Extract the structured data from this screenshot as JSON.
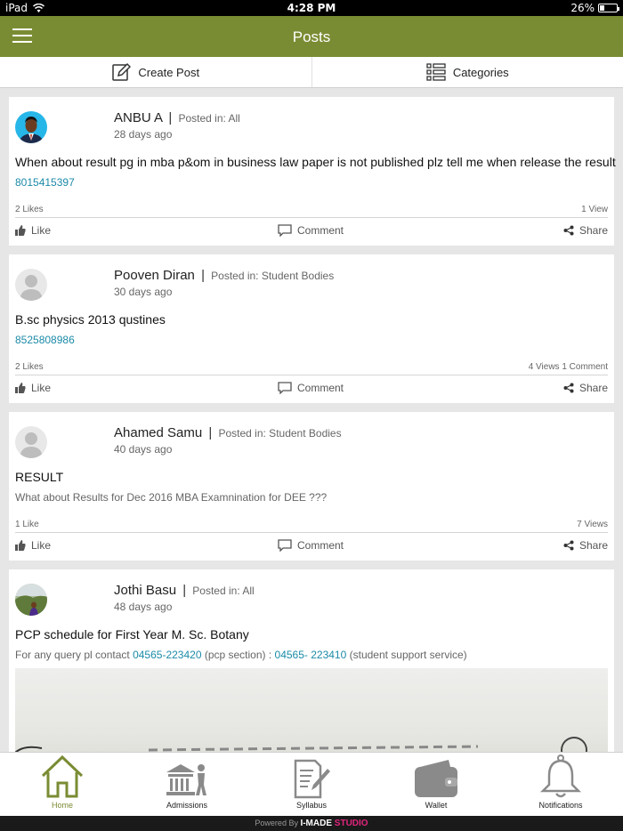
{
  "status": {
    "carrier": "iPad",
    "time": "4:28 PM",
    "battery": "26%"
  },
  "header": {
    "title": "Posts"
  },
  "actionbar": {
    "create_label": "Create Post",
    "categories_label": "Categories"
  },
  "actions": {
    "like": "Like",
    "comment": "Comment",
    "share": "Share"
  },
  "posts": [
    {
      "author": "ANBU A",
      "sep": "|",
      "posted_in": "Posted in: All",
      "ago": "28 days ago",
      "title": "When about result pg in mba p&om in business law paper is not published plz tell me when release the result",
      "body": "8015415397",
      "likes": "2 Likes",
      "views": "1 View"
    },
    {
      "author": "Pooven Diran",
      "sep": "|",
      "posted_in": "Posted in: Student Bodies",
      "ago": "30 days ago",
      "title": "B.sc physics 2013 qustines",
      "body": "8525808986",
      "likes": "2 Likes",
      "views": "4 Views 1 Comment"
    },
    {
      "author": "Ahamed Samu",
      "sep": "|",
      "posted_in": "Posted in: Student Bodies",
      "ago": "40 days ago",
      "title": "RESULT",
      "body": "What about Results for Dec 2016 MBA Examnination for DEE ???",
      "likes": "1 Like",
      "views": "7 Views"
    },
    {
      "author": "Jothi Basu",
      "sep": "|",
      "posted_in": "Posted in: All",
      "ago": "48 days ago",
      "title": "PCP schedule for First Year M. Sc. Botany",
      "body_prefix": "For any query pl contact ",
      "phone1": "04565-223420",
      "body_mid": " (pcp section) : ",
      "phone2": "04565- 223410",
      "body_suffix": " (student support service)"
    }
  ],
  "tabs": [
    {
      "label": "Home",
      "icon": "home-icon"
    },
    {
      "label": "Admissions",
      "icon": "admissions-icon"
    },
    {
      "label": "Syllabus",
      "icon": "syllabus-icon"
    },
    {
      "label": "Wallet",
      "icon": "wallet-icon"
    },
    {
      "label": "Notifications",
      "icon": "bell-icon"
    }
  ],
  "footer": {
    "powered": "Powered By ",
    "brand": "I-MADE",
    "brand2": " STUDIO"
  },
  "colors": {
    "primary": "#7a8c33",
    "link": "#1b8aa8"
  }
}
